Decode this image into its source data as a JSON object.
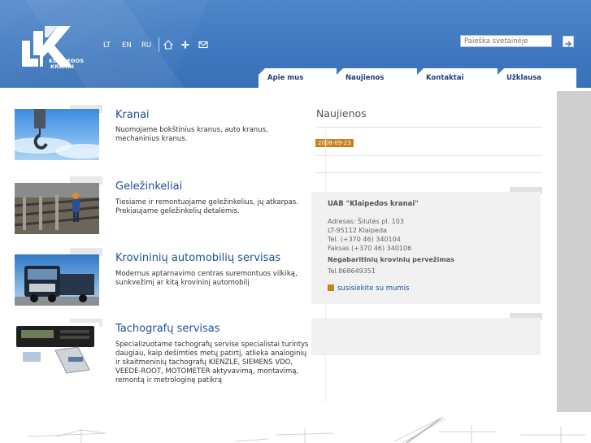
{
  "header": {
    "logo_text_line1": "KLAIPEDOS",
    "logo_text_line2": "KRANAI",
    "languages": [
      "LT",
      "EN",
      "RU"
    ],
    "icons": [
      "home-icon",
      "sitemap-icon",
      "mail-icon"
    ],
    "search_placeholder": "Paieška svetainėje"
  },
  "nav": {
    "tabs": [
      "Apie mus",
      "Naujienos",
      "Kontaktai",
      "Užklausa"
    ]
  },
  "items": [
    {
      "title": "Kranai",
      "text": "Nuomojame bokštinius kranus, auto kranus, mechaninius kranus."
    },
    {
      "title": "Geležinkeliai",
      "text": "Tiesiame ir remontuojame geležinkelius, jų atkarpas. Prekiaujame geležinkelių detalėmis."
    },
    {
      "title": "Krovininių automobilių servisas",
      "text": "Modernus aptarnavimo centras suremontuos vilkiką, sunkvežimį ar kitą krovininį automobilį"
    },
    {
      "title": "Tachografų servisas",
      "text": "Specializuotame tachografų servise specialistai turintys daugiau, kaip dešimties metų patirtį, atlieka analoginių ir skaitmeninių tachografų KIENZLE, SIEMENS VDO, VEEDE-ROOT, MOTOMETER aktyvavimą, montavimą, remontą ir metrologinę patikrą"
    }
  ],
  "news": {
    "title": "Naujienos",
    "date": "2008-09-23"
  },
  "contact": {
    "company": "UAB \"Klaipedos kranai\"",
    "address1": "Adresas: Šilutės pl. 103",
    "address2": "LT-95112 Klaipeda",
    "phone": "Tel. (+370 46) 340104",
    "fax": "Faksas (+370 46) 340106",
    "heavy_title": "Negabaritinių krovinių pervežimas",
    "heavy_phone": "Tel.868649351",
    "link": "susisiekite su mumis"
  },
  "colors": {
    "header_blue": "#3f78bf",
    "title_blue": "#1d4f9a",
    "accent_orange": "#c9801f"
  }
}
